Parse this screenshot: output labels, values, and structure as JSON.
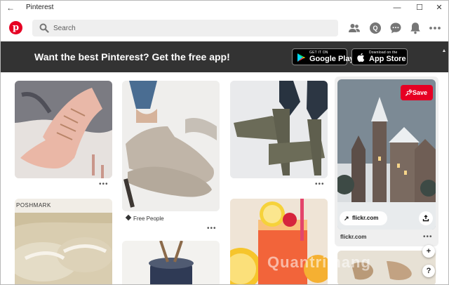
{
  "window": {
    "title": "Pinterest",
    "controls": {
      "minimize": "—",
      "maximize": "☐",
      "close": "✕"
    }
  },
  "header": {
    "logo_letter": "p",
    "search": {
      "placeholder": "Search"
    },
    "icons": [
      "people-icon",
      "profile-icon",
      "messages-icon",
      "notifications-icon",
      "more-icon"
    ],
    "profile_initial": "Q",
    "accent": "#e60023"
  },
  "banner": {
    "text": "Want the best Pinterest? Get the free app!",
    "google_play": {
      "small": "GET IT ON",
      "big": "Google Play"
    },
    "app_store": {
      "small": "Download on the",
      "big": "App Store"
    },
    "bg": "#333333"
  },
  "feed": {
    "pins": [
      {
        "id": "pink-boots",
        "more": "•••"
      },
      {
        "id": "poshmark-shoes",
        "brand": "POSHMARK"
      },
      {
        "id": "grey-loafers",
        "label": "Free People",
        "more": "•••"
      },
      {
        "id": "bottle-jar"
      },
      {
        "id": "olive-heels",
        "more": "•••"
      },
      {
        "id": "drink-lemon"
      },
      {
        "id": "winter-castle",
        "save_label": "Save",
        "link": "flickr.com",
        "domain": "flickr.com",
        "more": "•••"
      }
    ],
    "fab": {
      "add": "+",
      "help": "?"
    },
    "watermark": "Quantrimang"
  }
}
